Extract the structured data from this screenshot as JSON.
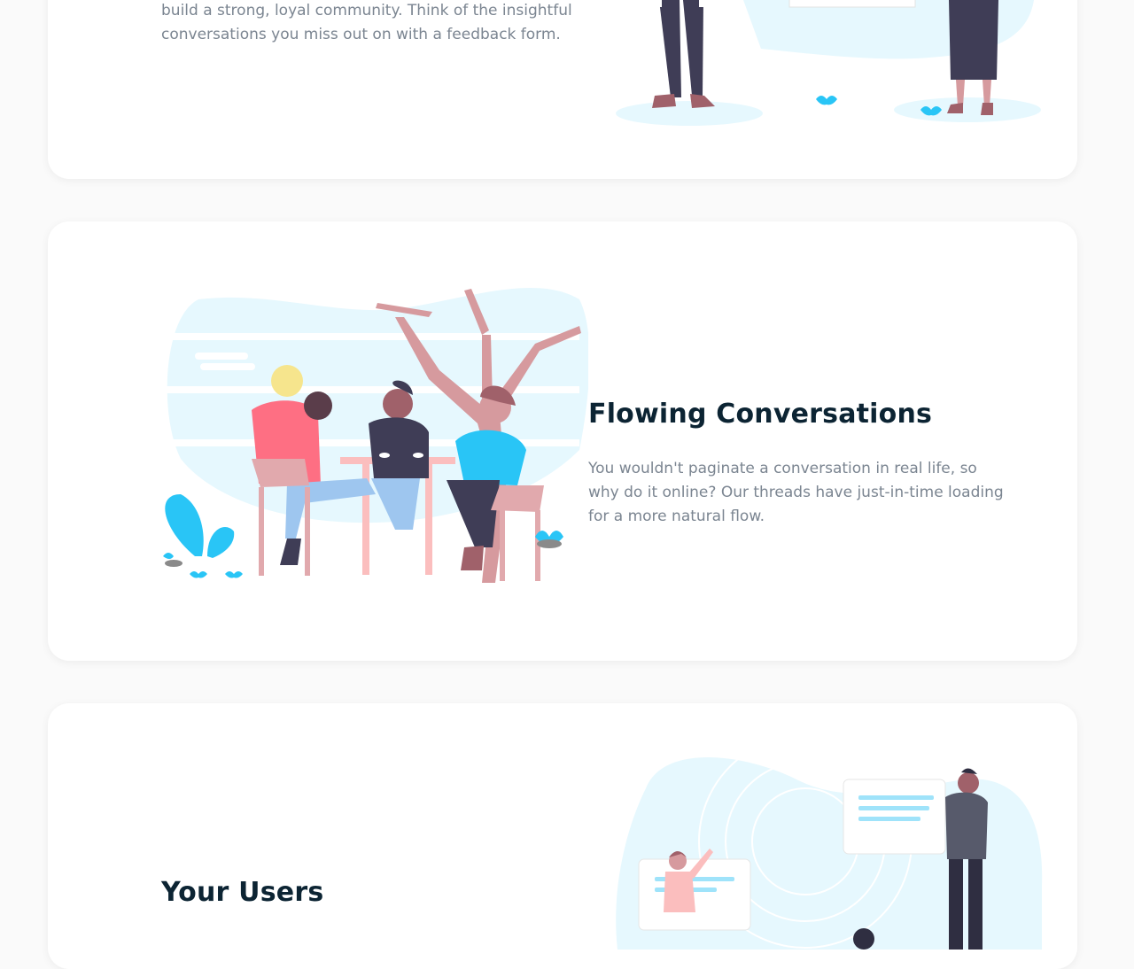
{
  "sections": [
    {
      "id": "community",
      "description": "build a strong, loyal community. Think of the insightful conversations you miss out on with a feedback form.",
      "illustration": "two-people-standing-illustration"
    },
    {
      "id": "flowing",
      "title": "Flowing Conversations",
      "description": "You wouldn't paginate a conversation in real life, so why do it online? Our threads have just-in-time loading for a more natural flow.",
      "illustration": "friends-at-table-illustration"
    },
    {
      "id": "users",
      "title": "Your Users",
      "illustration": "people-with-chat-bubbles-illustration"
    }
  ],
  "colors": {
    "heading": "#0c2433",
    "body_text": "#7b8591",
    "accent_light": "#e6f8fe",
    "accent_blue": "#29c5f6",
    "pink": "#fe6f83",
    "dark": "#3f3d56"
  }
}
